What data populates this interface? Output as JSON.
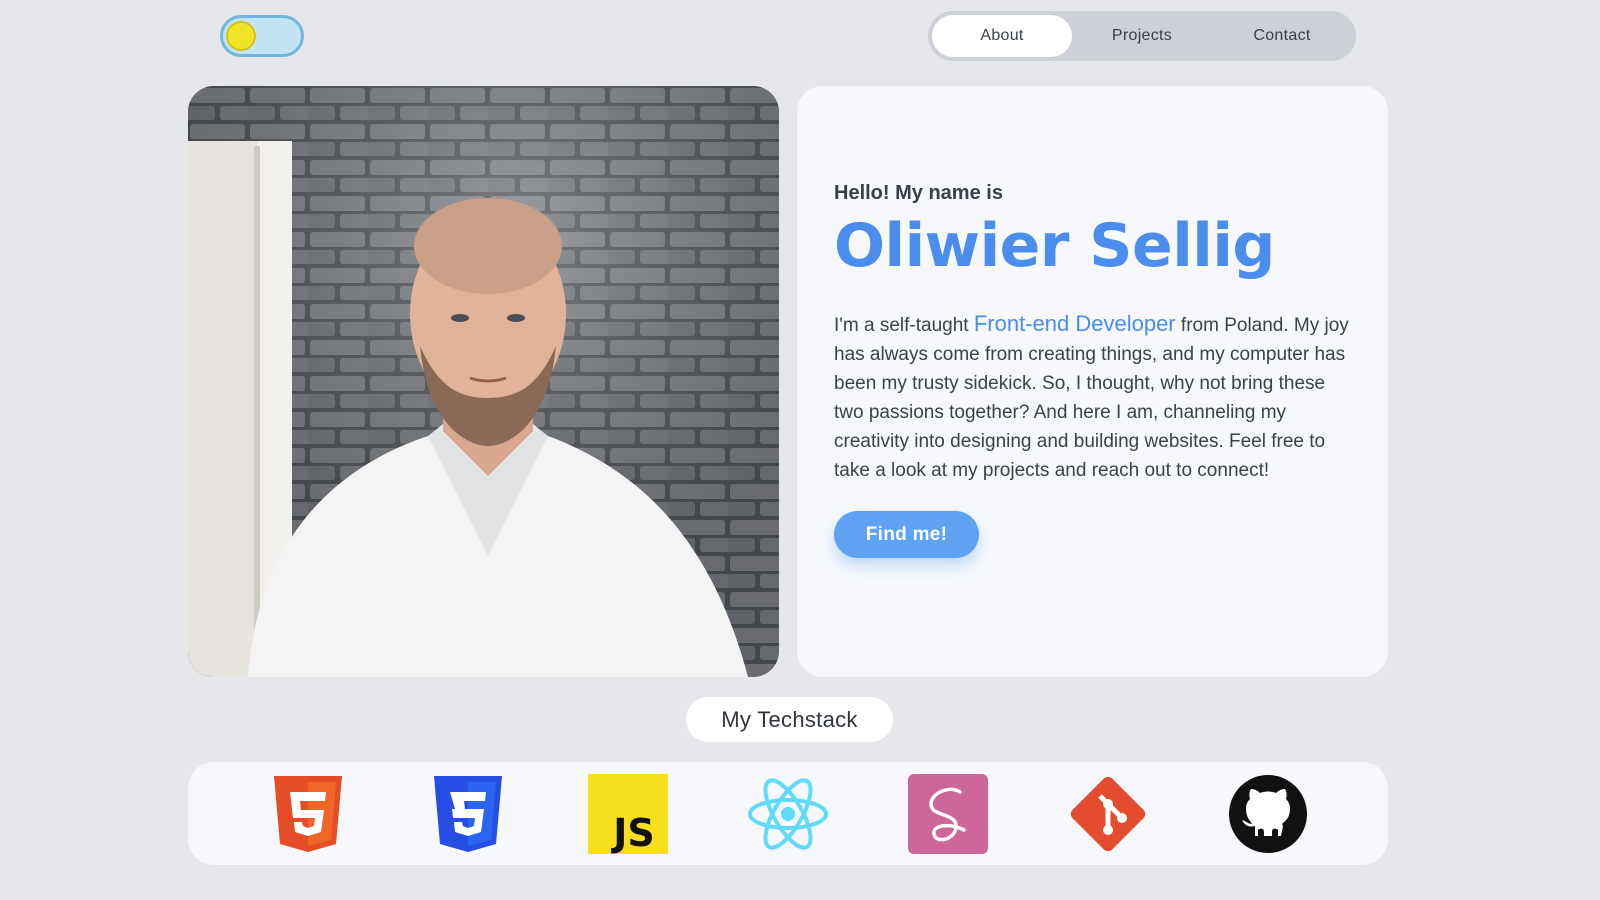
{
  "theme_toggle": {
    "state": "light",
    "knob_color": "#f1e426",
    "track_color": "#c3e3f4"
  },
  "nav": {
    "items": [
      {
        "label": "About",
        "active": true
      },
      {
        "label": "Projects",
        "active": false
      },
      {
        "label": "Contact",
        "active": false
      }
    ]
  },
  "intro": {
    "greeting": "Hello! My name is",
    "name": "Oliwier Sellig",
    "bio_before": "I'm a self-taught ",
    "bio_role": "Front-end Developer",
    "bio_after": " from Poland. My joy has always come from creating things, and my computer has been my trusty sidekick. So, I thought, why not bring these two passions together? And here I am, channeling my creativity into designing and building websites. Feel free to take a look at my projects and reach out to connect!",
    "button_label": "Find me!"
  },
  "techstack": {
    "title": "My Techstack",
    "icons": [
      "html5-icon",
      "css3-icon",
      "javascript-icon",
      "react-icon",
      "sass-icon",
      "git-icon",
      "github-icon"
    ]
  },
  "colors": {
    "accent": "#4a8ded",
    "button": "#5fa2f2",
    "background": "#e6e7ea",
    "card": "#f6f8fb"
  }
}
